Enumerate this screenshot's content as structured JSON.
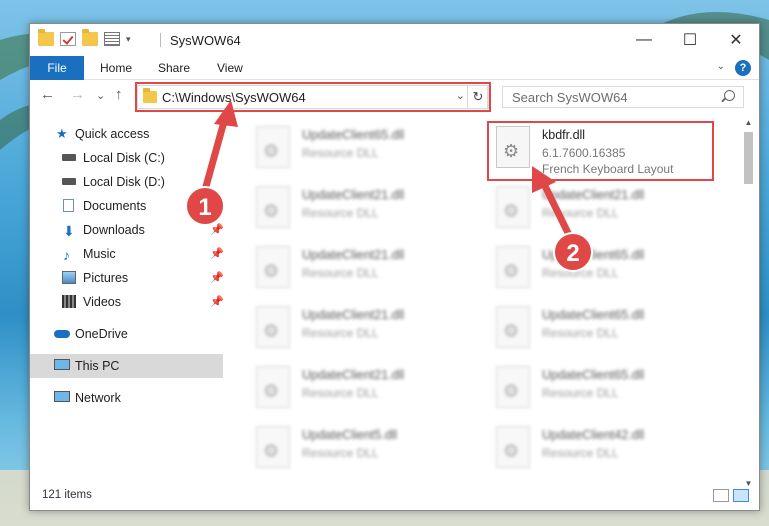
{
  "window": {
    "title": "SysWOW64",
    "controls": {
      "minimize": "—",
      "maximize": "☐",
      "close": "✕"
    }
  },
  "ribbon": {
    "tabs": [
      "File",
      "Home",
      "Share",
      "View"
    ],
    "help": "?"
  },
  "navbar": {
    "back": "←",
    "forward": "→",
    "recent": "⌄",
    "up": "↑",
    "address": "C:\\Windows\\SysWOW64",
    "refresh": "↻",
    "search_placeholder": "Search SysWOW64"
  },
  "sidebar": {
    "items": [
      {
        "label": "Quick access",
        "icon": "star-icon",
        "pinned": false
      },
      {
        "label": "Local Disk (C:)",
        "icon": "drive-icon",
        "pinned": false
      },
      {
        "label": "Local Disk (D:)",
        "icon": "drive-icon",
        "pinned": false
      },
      {
        "label": "Documents",
        "icon": "documents-icon",
        "pinned": true
      },
      {
        "label": "Downloads",
        "icon": "download-icon",
        "pinned": true
      },
      {
        "label": "Music",
        "icon": "music-icon",
        "pinned": true
      },
      {
        "label": "Pictures",
        "icon": "pictures-icon",
        "pinned": true
      },
      {
        "label": "Videos",
        "icon": "videos-icon",
        "pinned": true
      },
      {
        "label": "OneDrive",
        "icon": "cloud-icon",
        "pinned": false
      },
      {
        "label": "This PC",
        "icon": "computer-icon",
        "pinned": false,
        "selected": true
      },
      {
        "label": "Network",
        "icon": "network-icon",
        "pinned": false
      }
    ]
  },
  "files": {
    "left_column": [
      {
        "name": "UpdateClient65.dll",
        "type": "Resource DLL"
      },
      {
        "name": "UpdateClient21.dll",
        "type": "Resource DLL"
      },
      {
        "name": "UpdateClient21.dll",
        "type": "Resource DLL"
      },
      {
        "name": "UpdateClient21.dll",
        "type": "Resource DLL"
      },
      {
        "name": "UpdateClient21.dll",
        "type": "Resource DLL"
      },
      {
        "name": "UpdateClient5.dll",
        "type": "Resource DLL"
      }
    ],
    "highlighted": {
      "name": "kbdfr.dll",
      "version": "6.1.7600.16385",
      "description": "French Keyboard Layout"
    },
    "right_column": [
      {
        "name": "UpdateClient21.dll",
        "type": "Resource DLL"
      },
      {
        "name": "UpdateClient65.dll",
        "type": "Resource DLL"
      },
      {
        "name": "UpdateClient65.dll",
        "type": "Resource DLL"
      },
      {
        "name": "UpdateClient65.dll",
        "type": "Resource DLL"
      },
      {
        "name": "UpdateClient42.dll",
        "type": "Resource DLL"
      }
    ]
  },
  "status": {
    "item_count": "121 items"
  },
  "annotations": {
    "step1": "1",
    "step2": "2",
    "color": "#e04848"
  }
}
